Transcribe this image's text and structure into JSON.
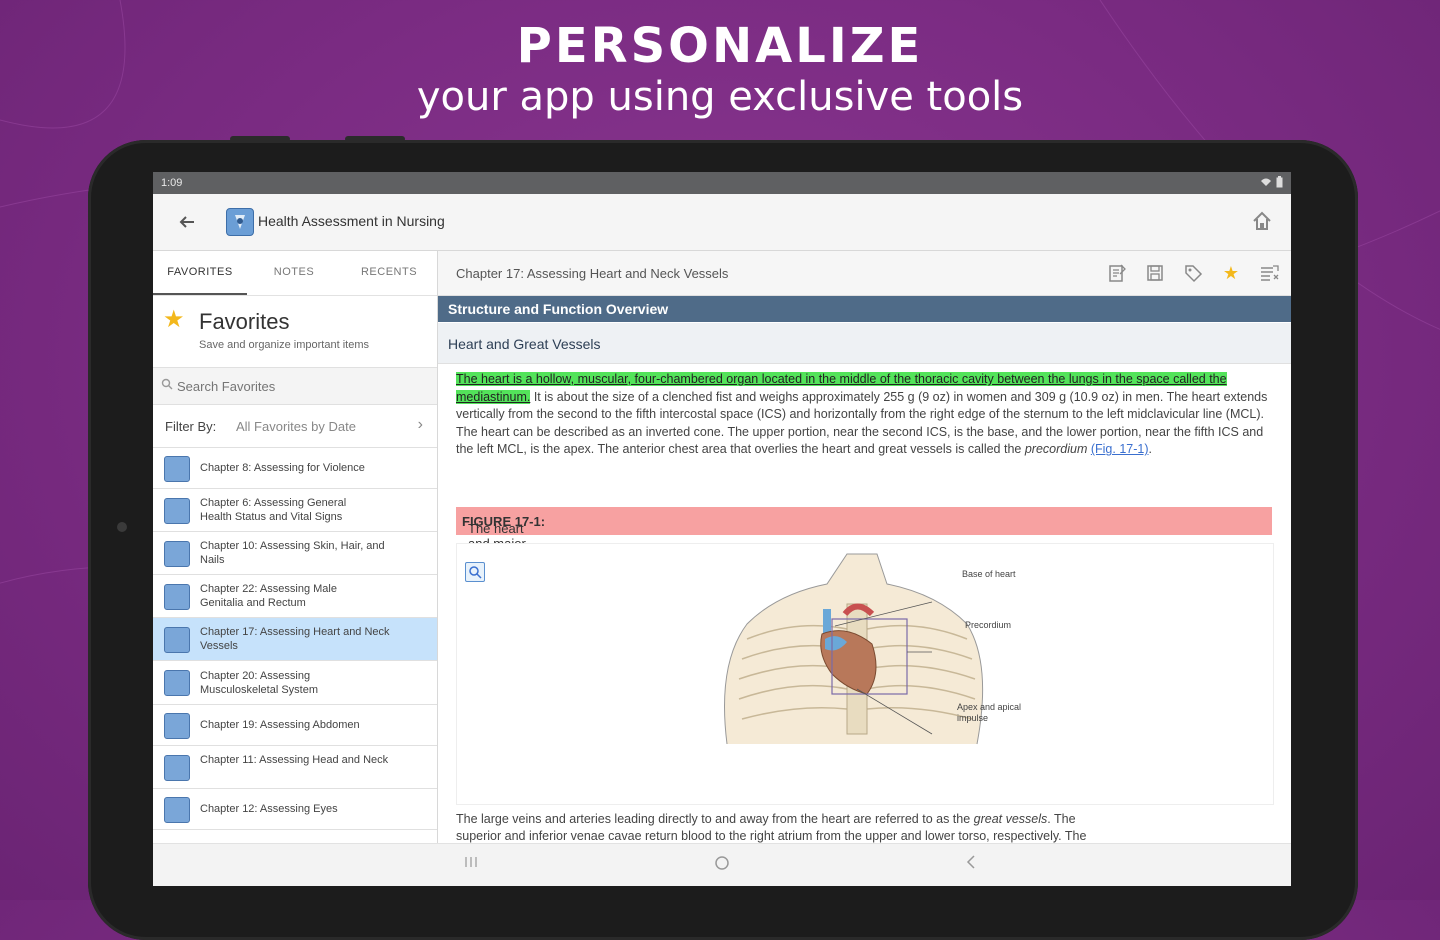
{
  "promo": {
    "title": "PERSONALIZE",
    "subtitle": "your app using exclusive tools"
  },
  "status_bar": {
    "time": "1:09"
  },
  "app_bar": {
    "title": "Health Assessment in Nursing",
    "back_icon": "back-arrow-icon",
    "home_icon": "home-icon"
  },
  "left_pane": {
    "tabs": [
      {
        "label": "FAVORITES",
        "active": true
      },
      {
        "label": "NOTES",
        "active": false
      },
      {
        "label": "RECENTS",
        "active": false
      }
    ],
    "header": {
      "title": "Favorites",
      "description": "Save and organize important items"
    },
    "search": {
      "placeholder": "Search Favorites"
    },
    "filter": {
      "label": "Filter By:",
      "value": "All Favorites by Date"
    },
    "items": [
      {
        "label": "Chapter 8: Assessing for Violence",
        "selected": false
      },
      {
        "label": "Chapter 6: Assessing General Health Status and Vital Signs",
        "selected": false
      },
      {
        "label": "Chapter 10: Assessing Skin, Hair, and Nails",
        "selected": false
      },
      {
        "label": "Chapter 22: Assessing Male Genitalia and Rectum",
        "selected": false
      },
      {
        "label": "Chapter 17: Assessing Heart and Neck Vessels",
        "selected": true
      },
      {
        "label": "Chapter 20: Assessing Musculoskeletal System",
        "selected": false
      },
      {
        "label": "Chapter 19: Assessing Abdomen",
        "selected": false
      },
      {
        "label": "Chapter 11: Assessing Head and Neck",
        "selected": false
      },
      {
        "label": "Chapter 12: Assessing Eyes",
        "selected": false
      }
    ]
  },
  "right_pane": {
    "chapter_title": "Chapter 17: Assessing Heart and Neck Vessels",
    "tool_icons": [
      "notes-icon",
      "save-icon",
      "tag-icon",
      "star-icon",
      "list-icon"
    ],
    "section_heading": "Structure and Function Overview",
    "subsection_heading": "Heart and Great Vessels",
    "paragraph": {
      "highlighted": "The heart is a hollow, muscular, four-chambered organ located in the middle of the thoracic cavity between the lungs in the space called the mediastinum.",
      "body": " It is about the size of a clenched fist and weighs approximately 255 g (9 oz) in women and 309 g (10.9 oz) in men. The heart extends vertically from the second to the fifth intercostal space (ICS) and horizontally from the right edge of the sternum to the left midclavicular line (MCL). The heart can be described as an inverted cone. The upper portion, near the second ICS, is the base, and the lower portion, near the fifth ICS and the left MCL, is the apex. The anterior chest area that overlies the heart and great vessels is called the ",
      "italic_term": "precordium",
      "link": "(Fig. 17-1)",
      "end": "."
    },
    "figure": {
      "caption_label": "FIGURE 17-1:",
      "caption_text": " The heart and major blood vessels lie centrally in the chest behind the protective sternum.",
      "labels": {
        "base": "Base of heart",
        "precordium": "Precordium",
        "apex": "Apex and apical impulse"
      }
    },
    "bottom_paragraph": {
      "line1_a": "The large veins and arteries leading directly to and away from the heart are referred to as the ",
      "line1_italic": "great vessels",
      "line1_b": ". The",
      "line2": "superior and inferior venae cavae return blood to the right atrium from the upper and lower torso, respectively. The"
    }
  },
  "colors": {
    "background": "#7a2b82",
    "section_heading": "#4f6b88",
    "highlight": "#53e35a",
    "caption": "#f7a1a1",
    "selected_item": "#c6e2fb",
    "star": "#f3b81c"
  }
}
